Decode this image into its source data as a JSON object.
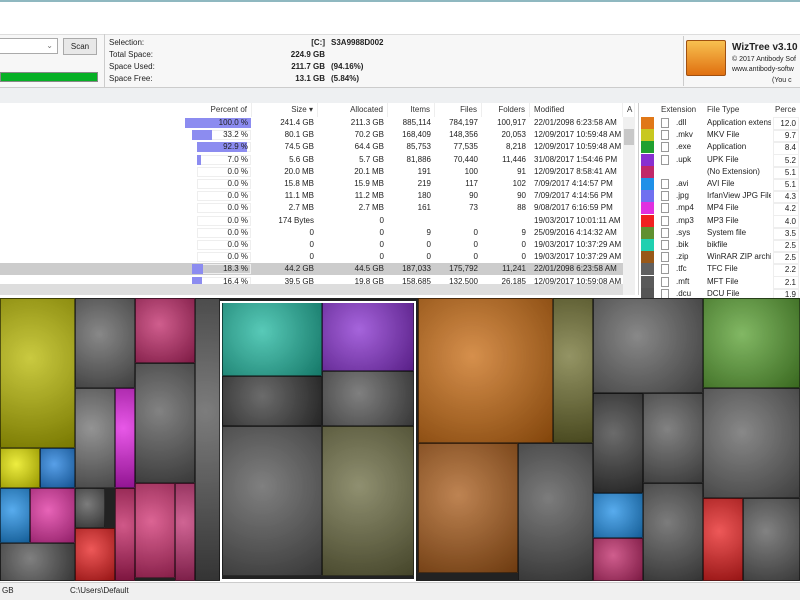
{
  "toolbar": {
    "scan_label": "Scan",
    "usage_percent": 94.16
  },
  "info": {
    "selection_label": "Selection:",
    "selection_value": "[C:]",
    "selection_name": "S3A9988D002",
    "total_label": "Total Space:",
    "total_value": "224.9 GB",
    "used_label": "Space Used:",
    "used_value": "211.7 GB",
    "used_pct": "(94.16%)",
    "free_label": "Space Free:",
    "free_value": "13.1 GB",
    "free_pct": "(5.84%)"
  },
  "logo": {
    "title": "WizTree v3.10 (",
    "copyright": "© 2017 Antibody Sof",
    "url": "www.antibody-softw",
    "note": "(You c"
  },
  "table": {
    "headers": [
      "Percent of Parent",
      "Size ▾",
      "Allocated",
      "Items",
      "Files",
      "Folders",
      "Modified",
      "A"
    ],
    "rows": [
      {
        "pct": "100.0 %",
        "p": 100,
        "size": "241.4 GB",
        "alloc": "211.3 GB",
        "items": "885,114",
        "files": "784,197",
        "folders": "100,917",
        "mod": "22/01/2098 6:23:58 AM"
      },
      {
        "pct": "33.2 %",
        "p": 33.2,
        "size": "80.1 GB",
        "alloc": "70.2 GB",
        "items": "168,409",
        "files": "148,356",
        "folders": "20,053",
        "mod": "12/09/2017 10:59:48 AM"
      },
      {
        "pct": "92.9 %",
        "p": 92.9,
        "size": "74.5 GB",
        "alloc": "64.4 GB",
        "items": "85,753",
        "files": "77,535",
        "folders": "8,218",
        "mod": "12/09/2017 10:59:48 AM"
      },
      {
        "pct": "7.0 %",
        "p": 7,
        "size": "5.6 GB",
        "alloc": "5.7 GB",
        "items": "81,886",
        "files": "70,440",
        "folders": "11,446",
        "mod": "31/08/2017 1:54:46 PM"
      },
      {
        "pct": "0.0 %",
        "p": 0,
        "size": "20.0 MB",
        "alloc": "20.1 MB",
        "items": "191",
        "files": "100",
        "folders": "91",
        "mod": "12/09/2017 8:58:41 AM"
      },
      {
        "pct": "0.0 %",
        "p": 0,
        "size": "15.8 MB",
        "alloc": "15.9 MB",
        "items": "219",
        "files": "117",
        "folders": "102",
        "mod": "7/09/2017 4:14:57 PM"
      },
      {
        "pct": "0.0 %",
        "p": 0,
        "size": "11.1 MB",
        "alloc": "11.2 MB",
        "items": "180",
        "files": "90",
        "folders": "90",
        "mod": "7/09/2017 4:14:56 PM"
      },
      {
        "pct": "0.0 %",
        "p": 0,
        "size": "2.7 MB",
        "alloc": "2.7 MB",
        "items": "161",
        "files": "73",
        "folders": "88",
        "mod": "9/08/2017 6:16:59 PM"
      },
      {
        "pct": "0.0 %",
        "p": 0,
        "size": "174 Bytes",
        "alloc": "0",
        "items": "",
        "files": "",
        "folders": "",
        "mod": "19/03/2017 10:01:11 AM"
      },
      {
        "pct": "0.0 %",
        "p": 0,
        "size": "0",
        "alloc": "0",
        "items": "9",
        "files": "0",
        "folders": "9",
        "mod": "25/09/2016 4:14:32 AM"
      },
      {
        "pct": "0.0 %",
        "p": 0,
        "size": "0",
        "alloc": "0",
        "items": "0",
        "files": "0",
        "folders": "0",
        "mod": "19/03/2017 10:37:29 AM"
      },
      {
        "pct": "0.0 %",
        "p": 0,
        "size": "0",
        "alloc": "0",
        "items": "0",
        "files": "0",
        "folders": "0",
        "mod": "19/03/2017 10:37:29 AM"
      },
      {
        "pct": "18.3 %",
        "p": 18.3,
        "size": "44.2 GB",
        "alloc": "44.5 GB",
        "items": "187,033",
        "files": "175,792",
        "folders": "11,241",
        "mod": "22/01/2098 6:23:58 AM"
      },
      {
        "pct": "16.4 %",
        "p": 16.4,
        "size": "39.5 GB",
        "alloc": "19.8 GB",
        "items": "158,685",
        "files": "132,500",
        "folders": "26,185",
        "mod": "12/09/2017 10:59:08 AM"
      }
    ]
  },
  "extensions": {
    "headers": [
      "Extension",
      "File Type",
      "Perce"
    ],
    "rows": [
      {
        "color": "#e07818",
        "ext": ".dll",
        "type": "Application extens",
        "pct": "12.0"
      },
      {
        "color": "#c8c820",
        "ext": ".mkv",
        "type": "MKV File",
        "pct": "9.7"
      },
      {
        "color": "#20a030",
        "ext": ".exe",
        "type": "Application",
        "pct": "8.4"
      },
      {
        "color": "#8830d0",
        "ext": ".upk",
        "type": "UPK File",
        "pct": "5.2"
      },
      {
        "color": "#c02868",
        "ext": "",
        "type": "(No Extension)",
        "pct": "5.1"
      },
      {
        "color": "#2090e8",
        "ext": ".avi",
        "type": "AVI File",
        "pct": "5.1"
      },
      {
        "color": "#7070f0",
        "ext": ".jpg",
        "type": "IrfanView JPG File",
        "pct": "4.3"
      },
      {
        "color": "#e030e0",
        "ext": ".mp4",
        "type": "MP4 File",
        "pct": "4.2"
      },
      {
        "color": "#f02020",
        "ext": ".mp3",
        "type": "MP3 File",
        "pct": "4.0"
      },
      {
        "color": "#609030",
        "ext": ".sys",
        "type": "System file",
        "pct": "3.5"
      },
      {
        "color": "#20d0b0",
        "ext": ".bik",
        "type": "bikfile",
        "pct": "2.5"
      },
      {
        "color": "#985818",
        "ext": ".zip",
        "type": "WinRAR ZIP archiv",
        "pct": "2.5"
      },
      {
        "color": "#606060",
        "ext": ".tfc",
        "type": "TFC File",
        "pct": "2.2"
      },
      {
        "color": "#5a5a5a",
        "ext": ".mft",
        "type": "MFT File",
        "pct": "2.1"
      },
      {
        "color": "#555555",
        "ext": ".dcu",
        "type": "DCU File",
        "pct": "1.9"
      }
    ]
  },
  "status": {
    "left": "GB",
    "path": "C:\\Users\\Default"
  }
}
